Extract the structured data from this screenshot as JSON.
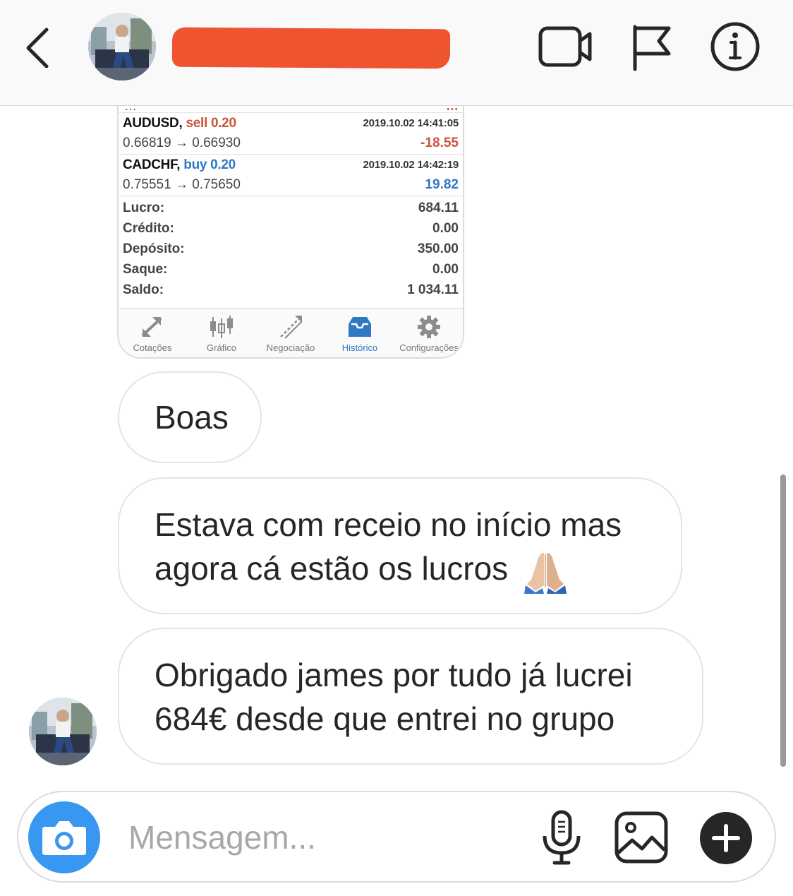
{
  "header": {
    "back_icon": "chevron-left-icon",
    "username_redacted": true,
    "actions": [
      {
        "name": "video-call",
        "icon": "video-camera-icon"
      },
      {
        "name": "report",
        "icon": "flag-icon"
      },
      {
        "name": "details",
        "icon": "info-icon"
      }
    ]
  },
  "screenshot": {
    "cut_row": {
      "left": "…",
      "right": "…"
    },
    "trades": [
      {
        "symbol": "AUDUSD,",
        "action": "sell",
        "volume": "0.20",
        "datetime": "2019.10.02 14:41:05",
        "prices": "0.66819 → 0.66930",
        "profit": "-18.55",
        "color": "#c9553a"
      },
      {
        "symbol": "CADCHF,",
        "action": "buy",
        "volume": "0.20",
        "datetime": "2019.10.02 14:42:19",
        "prices": "0.75551 → 0.75650",
        "profit": "19.82",
        "color": "#2e78c4"
      }
    ],
    "summary": [
      {
        "label": "Lucro:",
        "value": "684.11"
      },
      {
        "label": "Crédito:",
        "value": "0.00"
      },
      {
        "label": "Depósito:",
        "value": "350.00"
      },
      {
        "label": "Saque:",
        "value": "0.00"
      },
      {
        "label": "Saldo:",
        "value": "1 034.11"
      }
    ],
    "tabs": [
      {
        "label": "Cotações",
        "icon": "quotes-arrows-icon",
        "active": false
      },
      {
        "label": "Gráfico",
        "icon": "candlestick-icon",
        "active": false
      },
      {
        "label": "Negociação",
        "icon": "trade-icon",
        "active": false
      },
      {
        "label": "Histórico",
        "icon": "history-inbox-icon",
        "active": true
      },
      {
        "label": "Configurações",
        "icon": "settings-gear-icon",
        "active": false
      }
    ]
  },
  "messages": [
    {
      "text": "Boas"
    },
    {
      "text_line1": "Estava com receio no início mas",
      "text_line2": "agora cá estão os lucros",
      "emoji": "folded-hands-emoji"
    },
    {
      "text_line1": "Obrigado james por tudo já lucrei",
      "text_line2": "684€ desde que entrei no grupo"
    }
  ],
  "composer": {
    "placeholder": "Mensagem...",
    "value": "",
    "camera_icon": "camera-icon",
    "mic_icon": "microphone-icon",
    "gallery_icon": "image-icon",
    "plus_icon": "plus-icon",
    "accent_color": "#3897f0"
  }
}
